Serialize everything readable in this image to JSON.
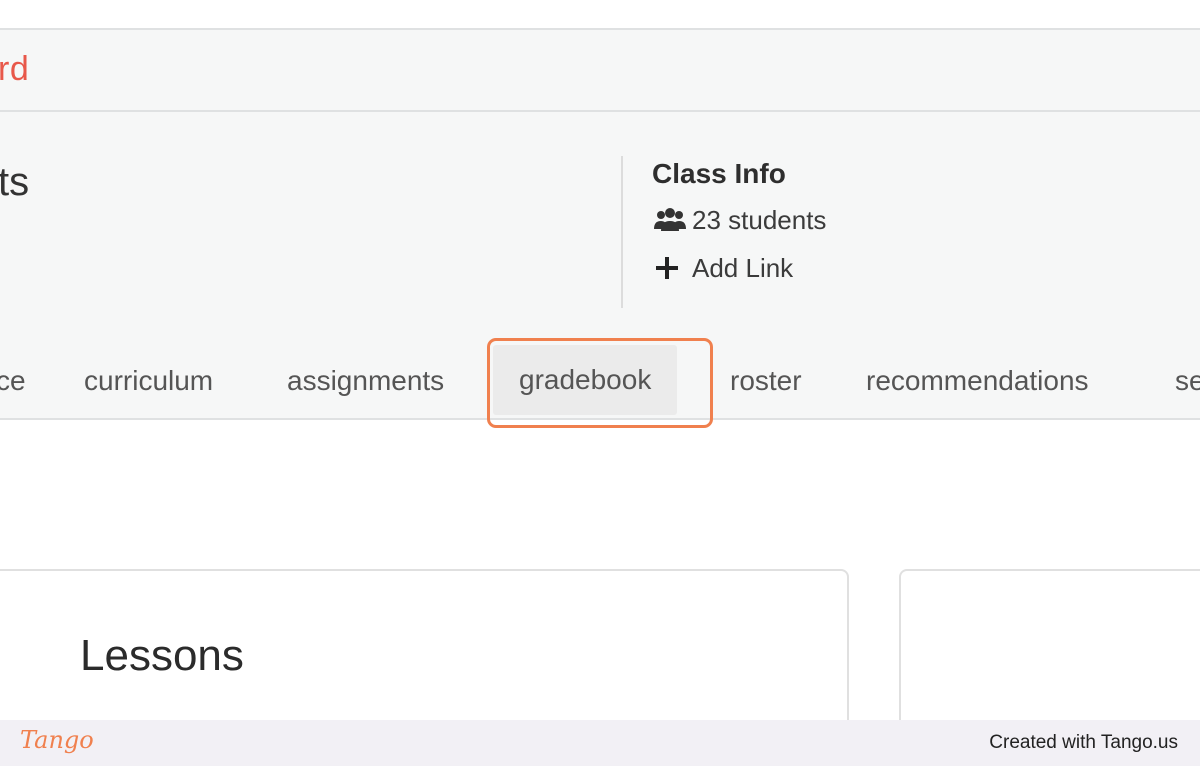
{
  "breadcrumb": {
    "text": "rd"
  },
  "header": {
    "class_title": "ts",
    "class_info": {
      "title": "Class Info",
      "students": "23 students",
      "add_link": "Add Link"
    }
  },
  "tabs": [
    {
      "label": "ce",
      "active": false
    },
    {
      "label": "curriculum",
      "active": false
    },
    {
      "label": "assignments",
      "active": false
    },
    {
      "label": "gradebook",
      "active": true
    },
    {
      "label": "roster",
      "active": false
    },
    {
      "label": "recommendations",
      "active": false
    },
    {
      "label": "se",
      "active": false
    }
  ],
  "cards": {
    "lessons_title": "Lessons"
  },
  "footer": {
    "brand": "Tango",
    "credit": "Created with Tango.us"
  },
  "colors": {
    "accent": "#e8584a",
    "highlight": "#f0804e"
  },
  "icons": {
    "students": "users-icon",
    "add_link": "plus-icon"
  }
}
